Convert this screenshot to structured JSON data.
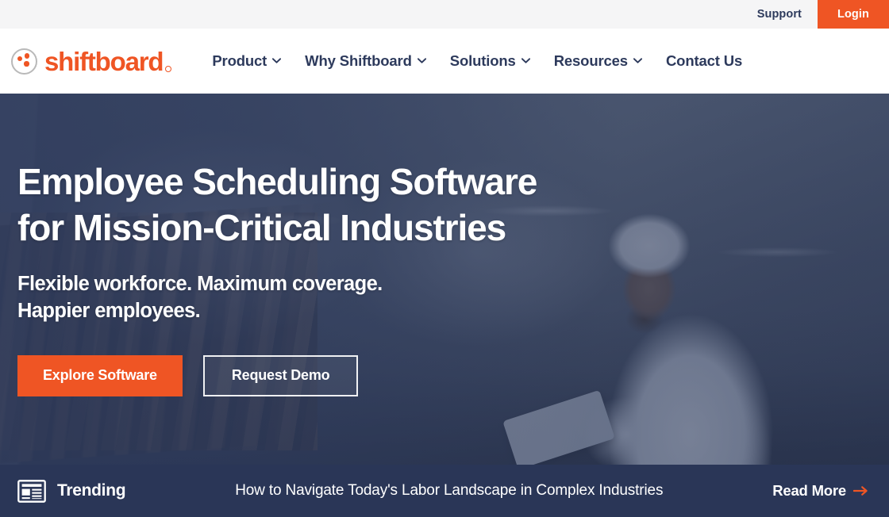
{
  "brand": {
    "name": "shiftboard",
    "logo_icon": "shiftboard-circle-dots-logo",
    "accent_color": "#ef5524",
    "navy_color": "#2d3a5c"
  },
  "utility_bar": {
    "support_label": "Support",
    "login_label": "Login"
  },
  "nav": {
    "items": [
      {
        "label": "Product",
        "has_dropdown": true,
        "icon": "chevron-down-icon"
      },
      {
        "label": "Why Shiftboard",
        "has_dropdown": true,
        "icon": "chevron-down-icon"
      },
      {
        "label": "Solutions",
        "has_dropdown": true,
        "icon": "chevron-down-icon"
      },
      {
        "label": "Resources",
        "has_dropdown": true,
        "icon": "chevron-down-icon"
      },
      {
        "label": "Contact Us",
        "has_dropdown": false,
        "icon": ""
      }
    ]
  },
  "hero": {
    "title_line1": "Employee Scheduling Software",
    "title_line2": "for Mission-Critical Industries",
    "subtitle_line1": "Flexible workforce. Maximum coverage.",
    "subtitle_line2": "Happier employees.",
    "primary_cta": "Explore Software",
    "secondary_cta": "Request Demo",
    "background_description": "Industrial facility worker in white coveralls and hairnet holding a tablet beside a bottling conveyor line, dark navy overlay",
    "overlay_color": "#2d3a5c"
  },
  "trending": {
    "icon": "newspaper-icon",
    "label": "Trending",
    "headline": "How to Navigate Today's Labor Landscape in Complex Industries",
    "read_more_label": "Read More",
    "read_more_icon": "arrow-right-icon",
    "bar_color": "#2a3657",
    "arrow_color": "#ef5524"
  }
}
